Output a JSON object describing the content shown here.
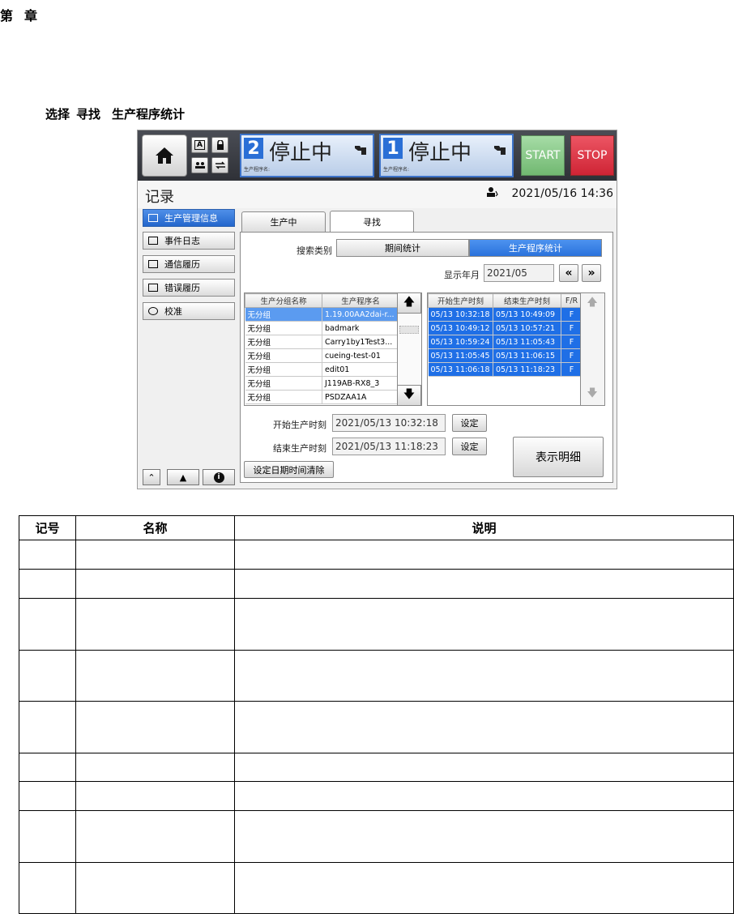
{
  "page": {
    "chapter": [
      "第",
      "章"
    ],
    "section_title": [
      "选择",
      "寻找",
      "生产程序统计"
    ]
  },
  "topbar": {
    "lane2": {
      "num": "2",
      "status": "停止中",
      "label": "生产程序名:"
    },
    "lane1": {
      "num": "1",
      "status": "停止中",
      "label": "生产程序名:"
    },
    "start_label": "START",
    "stop_label": "STOP",
    "mini_a_label": "A"
  },
  "titlebar": {
    "title": "记录",
    "datetime": "2021/05/16 14:36"
  },
  "sidebar": {
    "items": [
      {
        "label": "生产管理信息"
      },
      {
        "label": "事件日志"
      },
      {
        "label": "通信履历"
      },
      {
        "label": "错误履历"
      },
      {
        "label": "校准"
      }
    ]
  },
  "tabs": [
    {
      "label": "生产中"
    },
    {
      "label": "寻找"
    }
  ],
  "search": {
    "category_label": "搜索类别",
    "option_period": "期间统计",
    "option_program": "生产程序统计",
    "month_label": "显示年月",
    "month_value": "2021/05",
    "prev_label": "«",
    "next_label": "»"
  },
  "left_table": {
    "headers": [
      "生产分组名称",
      "生产程序名"
    ],
    "rows": [
      [
        "无分组",
        "1.19.00AA2dai-r..."
      ],
      [
        "无分组",
        "badmark"
      ],
      [
        "无分组",
        "Carry1by1Test3..."
      ],
      [
        "无分组",
        "cueing-test-01"
      ],
      [
        "无分组",
        "edit01"
      ],
      [
        "无分组",
        "J119AB-RX8_3"
      ],
      [
        "无分组",
        "PSDZAA1A"
      ]
    ]
  },
  "right_table": {
    "headers": [
      "开始生产时刻",
      "结束生产时刻",
      "F/R"
    ],
    "rows": [
      [
        "05/13 10:32:18",
        "05/13 10:49:09",
        "F"
      ],
      [
        "05/13 10:49:12",
        "05/13 10:57:21",
        "F"
      ],
      [
        "05/13 10:59:24",
        "05/13 11:05:43",
        "F"
      ],
      [
        "05/13 11:05:45",
        "05/13 11:06:15",
        "F"
      ],
      [
        "05/13 11:06:18",
        "05/13 11:18:23",
        "F"
      ]
    ]
  },
  "times": {
    "start_label": "开始生产时刻",
    "start_value": "2021/05/13 10:32:18",
    "end_label": "结束生产时刻",
    "end_value": "2021/05/13 11:18:23",
    "set_label": "设定",
    "clear_label": "设定日期时间清除",
    "detail_label": "表示明细"
  },
  "spec_table": {
    "headers": [
      "记号",
      "名称",
      "说明"
    ],
    "row_count": 9
  }
}
